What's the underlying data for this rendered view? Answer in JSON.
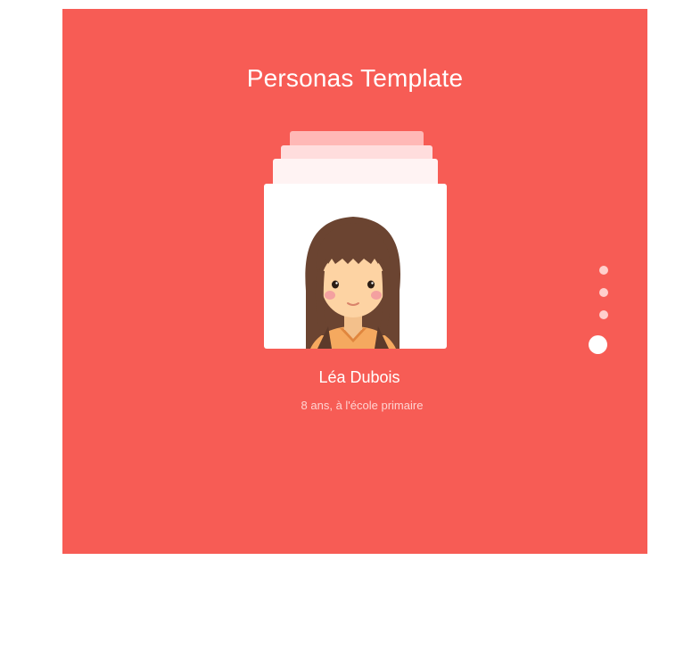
{
  "page": {
    "title": "Personas Template"
  },
  "persona": {
    "name": "Léa Dubois",
    "description": "8 ans, à l'école primaire",
    "avatar_icon": "girl-avatar-icon"
  },
  "pagination": {
    "count": 4,
    "active_index": 3
  },
  "colors": {
    "background": "#f75c55",
    "card": "#ffffff",
    "hair": "#6b4431",
    "skin": "#fdd3a3",
    "shirt": "#f5a95f"
  }
}
